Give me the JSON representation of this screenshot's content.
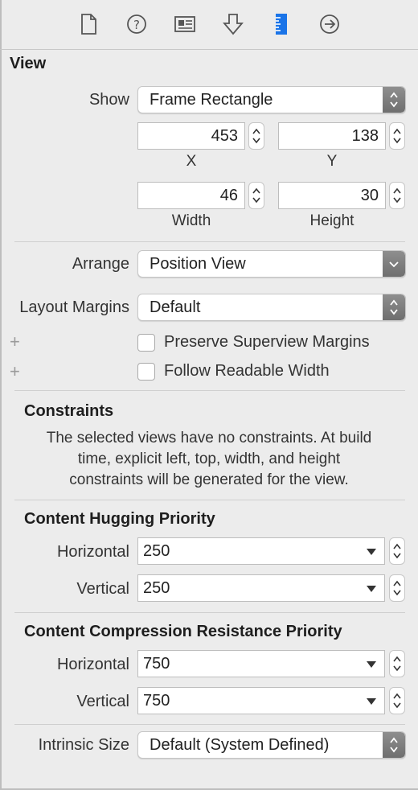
{
  "toolbar": {
    "tabs": [
      "file-inspector-icon",
      "help-icon",
      "identity-icon",
      "attributes-icon",
      "size-inspector-icon",
      "connections-icon"
    ],
    "active_color": "#1a74e8"
  },
  "view": {
    "title": "View",
    "show_label": "Show",
    "show_value": "Frame Rectangle",
    "x_value": "453",
    "x_label": "X",
    "y_value": "138",
    "y_label": "Y",
    "width_value": "46",
    "width_label": "Width",
    "height_value": "30",
    "height_label": "Height",
    "arrange_label": "Arrange",
    "arrange_value": "Position View",
    "margins_label": "Layout Margins",
    "margins_value": "Default",
    "preserve_label": "Preserve Superview Margins",
    "follow_label": "Follow Readable Width",
    "plus_symbol": "+"
  },
  "constraints": {
    "title": "Constraints",
    "line1": "The selected views have no constraints. At build",
    "line2": "time, explicit left, top, width, and height",
    "line3": "constraints will be generated for the view."
  },
  "hugging": {
    "title": "Content Hugging Priority",
    "horizontal_label": "Horizontal",
    "horizontal_value": "250",
    "vertical_label": "Vertical",
    "vertical_value": "250"
  },
  "compression": {
    "title": "Content Compression Resistance Priority",
    "horizontal_label": "Horizontal",
    "horizontal_value": "750",
    "vertical_label": "Vertical",
    "vertical_value": "750"
  },
  "intrinsic": {
    "label": "Intrinsic Size",
    "value": "Default (System Defined)"
  }
}
